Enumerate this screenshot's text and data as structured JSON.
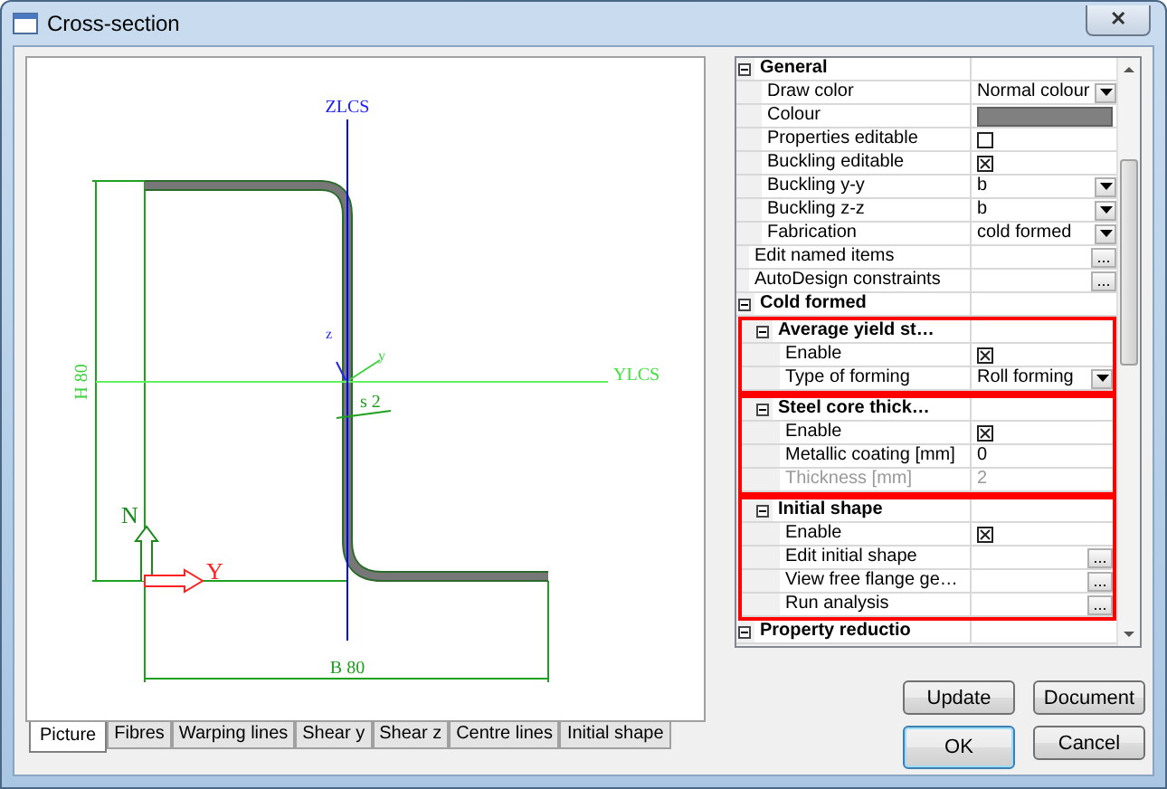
{
  "window": {
    "title": "Cross-section",
    "close_symbol": "✕"
  },
  "drawing": {
    "z_axis_label": "ZLCS",
    "y_axis_label": "YLCS",
    "height_dimension": "H 80",
    "width_dimension": "B 80",
    "thickness_label": "s 2",
    "local_z_label": "z",
    "local_y_label": "y",
    "origin_z_label": "N",
    "origin_y_label": "Y"
  },
  "tabs": [
    {
      "label": "Picture",
      "selected": true
    },
    {
      "label": "Fibres",
      "selected": false
    },
    {
      "label": "Warping lines",
      "selected": false
    },
    {
      "label": "Shear y",
      "selected": false
    },
    {
      "label": "Shear z",
      "selected": false
    },
    {
      "label": "Centre lines",
      "selected": false
    },
    {
      "label": "Initial shape",
      "selected": false
    }
  ],
  "properties": [
    {
      "kind": "category",
      "label": "General",
      "expanded": true,
      "highlighted": false,
      "children": [
        {
          "kind": "dropdown",
          "label": "Draw color",
          "value": "Normal colour"
        },
        {
          "kind": "color",
          "label": "Colour",
          "color": "#808080"
        },
        {
          "kind": "checkbox",
          "label": "Properties editable",
          "checked": false
        },
        {
          "kind": "checkbox",
          "label": "Buckling editable",
          "checked": true
        },
        {
          "kind": "dropdown",
          "label": "Buckling y-y",
          "value": "b"
        },
        {
          "kind": "dropdown",
          "label": "Buckling z-z",
          "value": "b"
        },
        {
          "kind": "dropdown",
          "label": "Fabrication",
          "value": "cold formed"
        }
      ]
    },
    {
      "kind": "button",
      "label": "Edit named items",
      "button_text": "..."
    },
    {
      "kind": "button",
      "label": "AutoDesign constraints",
      "button_text": "..."
    },
    {
      "kind": "category",
      "label": "Cold formed",
      "expanded": true,
      "highlighted": false,
      "children": [
        {
          "kind": "category",
          "label": "Average yield st…",
          "expanded": true,
          "highlighted": true,
          "children": [
            {
              "kind": "checkbox",
              "label": "Enable",
              "checked": true
            },
            {
              "kind": "dropdown",
              "label": "Type of forming",
              "value": "Roll forming"
            }
          ]
        },
        {
          "kind": "category",
          "label": "Steel core thick…",
          "expanded": true,
          "highlighted": true,
          "children": [
            {
              "kind": "checkbox",
              "label": "Enable",
              "checked": true
            },
            {
              "kind": "text",
              "label": "Metallic coating [mm]",
              "value": "0",
              "disabled": false
            },
            {
              "kind": "text",
              "label": "Thickness [mm]",
              "value": "2",
              "disabled": true
            }
          ]
        },
        {
          "kind": "category",
          "label": "Initial shape",
          "expanded": true,
          "highlighted": true,
          "children": [
            {
              "kind": "checkbox",
              "label": "Enable",
              "checked": true
            },
            {
              "kind": "button",
              "label": "Edit initial shape",
              "button_text": "..."
            },
            {
              "kind": "button",
              "label": "View free flange ge…",
              "button_text": "..."
            },
            {
              "kind": "button",
              "label": "Run analysis",
              "button_text": "..."
            }
          ]
        }
      ]
    },
    {
      "kind": "category",
      "label": "Property reductio",
      "expanded": true,
      "highlighted": false
    }
  ],
  "buttons": [
    {
      "label": "Update",
      "default": false
    },
    {
      "label": "Document",
      "default": false
    },
    {
      "label": "OK",
      "default": true
    },
    {
      "label": "Cancel",
      "default": false
    }
  ]
}
